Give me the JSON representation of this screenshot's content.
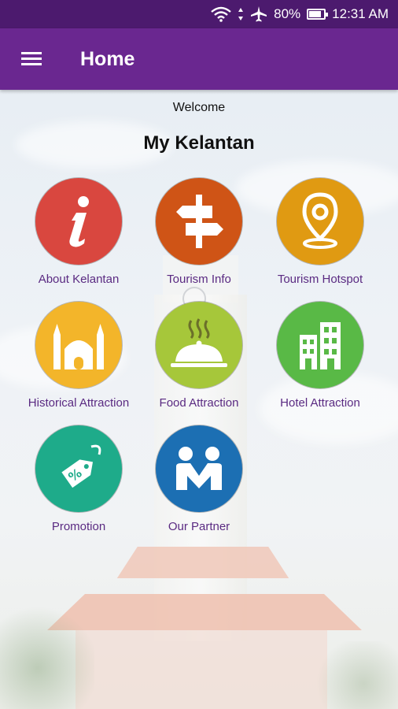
{
  "status_bar": {
    "battery": "80%",
    "time": "12:31 AM",
    "battery_level": 0.8
  },
  "app_bar": {
    "title": "Home",
    "menu_icon": "hamburger-menu-icon"
  },
  "content": {
    "welcome": "Welcome",
    "heading": "My Kelantan"
  },
  "tiles": [
    {
      "label": "About Kelantan",
      "color": "#d9473f",
      "icon": "info-icon"
    },
    {
      "label": "Tourism Info",
      "color": "#cf5416",
      "icon": "signpost-icon"
    },
    {
      "label": "Tourism Hotspot",
      "color": "#e09a12",
      "icon": "location-pin-icon"
    },
    {
      "label": "Historical Attraction",
      "color": "#f3b52a",
      "icon": "mosque-icon"
    },
    {
      "label": "Food Attraction",
      "color": "#a6c73a",
      "icon": "cloche-icon"
    },
    {
      "label": "Hotel Attraction",
      "color": "#59b946",
      "icon": "buildings-icon"
    },
    {
      "label": "Promotion",
      "color": "#1eab8a",
      "icon": "price-tag-icon"
    },
    {
      "label": "Our Partner",
      "color": "#1c6fb3",
      "icon": "partners-icon"
    }
  ]
}
